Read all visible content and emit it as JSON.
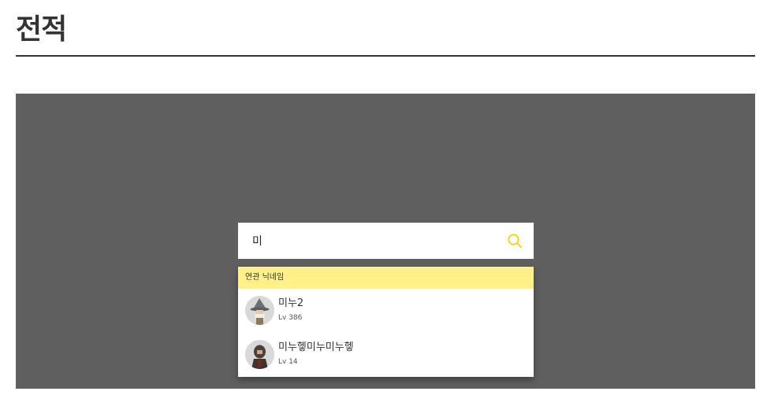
{
  "page": {
    "title": "전적"
  },
  "search": {
    "value": "미",
    "icon": "search-icon",
    "icon_color": "#f5d400"
  },
  "suggestions": {
    "header": "연관 닉네임",
    "header_color": "#fff08a",
    "items": [
      {
        "name": "미누2",
        "level": "Lv 386",
        "avatar": "wizard-character-avatar"
      },
      {
        "name": "미누헿미누미누헿",
        "level": "Lv 14",
        "avatar": "hooded-character-avatar"
      }
    ]
  },
  "colors": {
    "panel_background": "#5f5f5f",
    "title_text": "#333333"
  }
}
